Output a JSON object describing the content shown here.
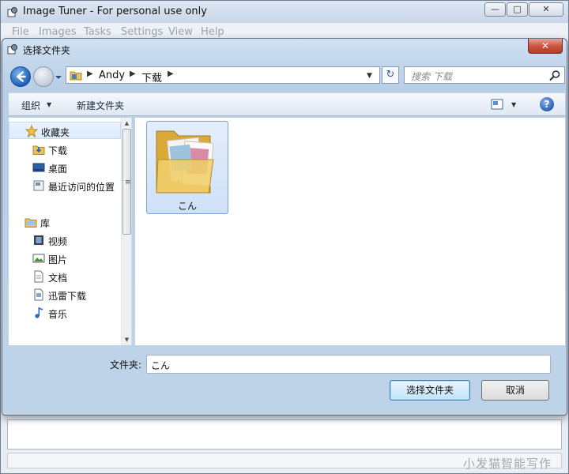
{
  "app": {
    "title": "Image Tuner - For personal use only",
    "menu": [
      "File",
      "Images",
      "Tasks",
      "Settings",
      "View",
      "Help"
    ]
  },
  "dialog": {
    "title": "选择文件夹",
    "breadcrumb": [
      "Andy",
      "下载"
    ],
    "search_placeholder": "搜索 下载",
    "toolbar": {
      "organize_label": "组织",
      "new_folder_label": "新建文件夹"
    },
    "nav": {
      "favorites_label": "收藏夹",
      "favorites": [
        "下载",
        "桌面",
        "最近访问的位置"
      ],
      "library_label": "库",
      "library": [
        "视频",
        "图片",
        "文档",
        "迅雷下载",
        "音乐"
      ]
    },
    "files": [
      {
        "name": "こん",
        "type": "folder"
      }
    ],
    "folder_field_label": "文件夹:",
    "folder_field_value": "こん",
    "select_button_label": "选择文件夹",
    "cancel_button_label": "取消"
  },
  "watermark": "小发猫智能写作",
  "colors": {
    "accent": "#3c7fb1",
    "close_red": "#c8513c",
    "selection": "#cfe1f7"
  }
}
